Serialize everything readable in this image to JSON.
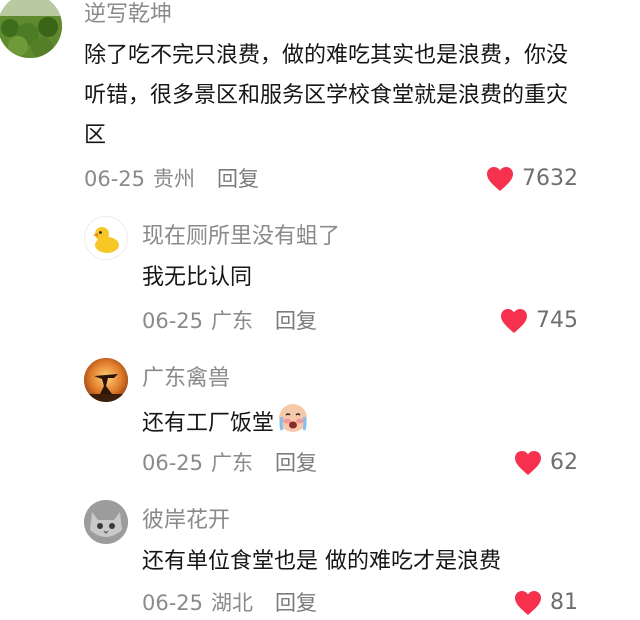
{
  "comments": [
    {
      "username": "逆写乾坤",
      "lines": [
        "除了吃不完只浪费，做的难吃其实也是浪费，你没",
        "听错，很多景区和服务区学校食堂就是浪费的重灾",
        "区"
      ],
      "date": "06-25",
      "location": "贵州",
      "reply_label": "回复",
      "likes": "7632",
      "avatar_icon": "plant-field-avatar"
    },
    {
      "username": "现在厕所里没有蛆了",
      "lines": [
        "我无比认同"
      ],
      "date": "06-25",
      "location": "广东",
      "reply_label": "回复",
      "likes": "745",
      "avatar_icon": "yellow-duck-avatar"
    },
    {
      "username": "广东禽兽",
      "lines": [
        "还有工厂饭堂"
      ],
      "date": "06-25",
      "location": "广东",
      "reply_label": "回复",
      "likes": "62",
      "avatar_icon": "sunset-silhouette-avatar",
      "emoji": "crying-face-emoji"
    },
    {
      "username": "彼岸花开",
      "lines": [
        "还有单位食堂也是 做的难吃才是浪费"
      ],
      "date": "06-25",
      "location": "湖北",
      "reply_label": "回复",
      "likes": "81",
      "avatar_icon": "gray-cat-avatar"
    }
  ],
  "colors": {
    "heart": "#f5314e",
    "username": "#8a8a8a",
    "text": "#161616"
  }
}
